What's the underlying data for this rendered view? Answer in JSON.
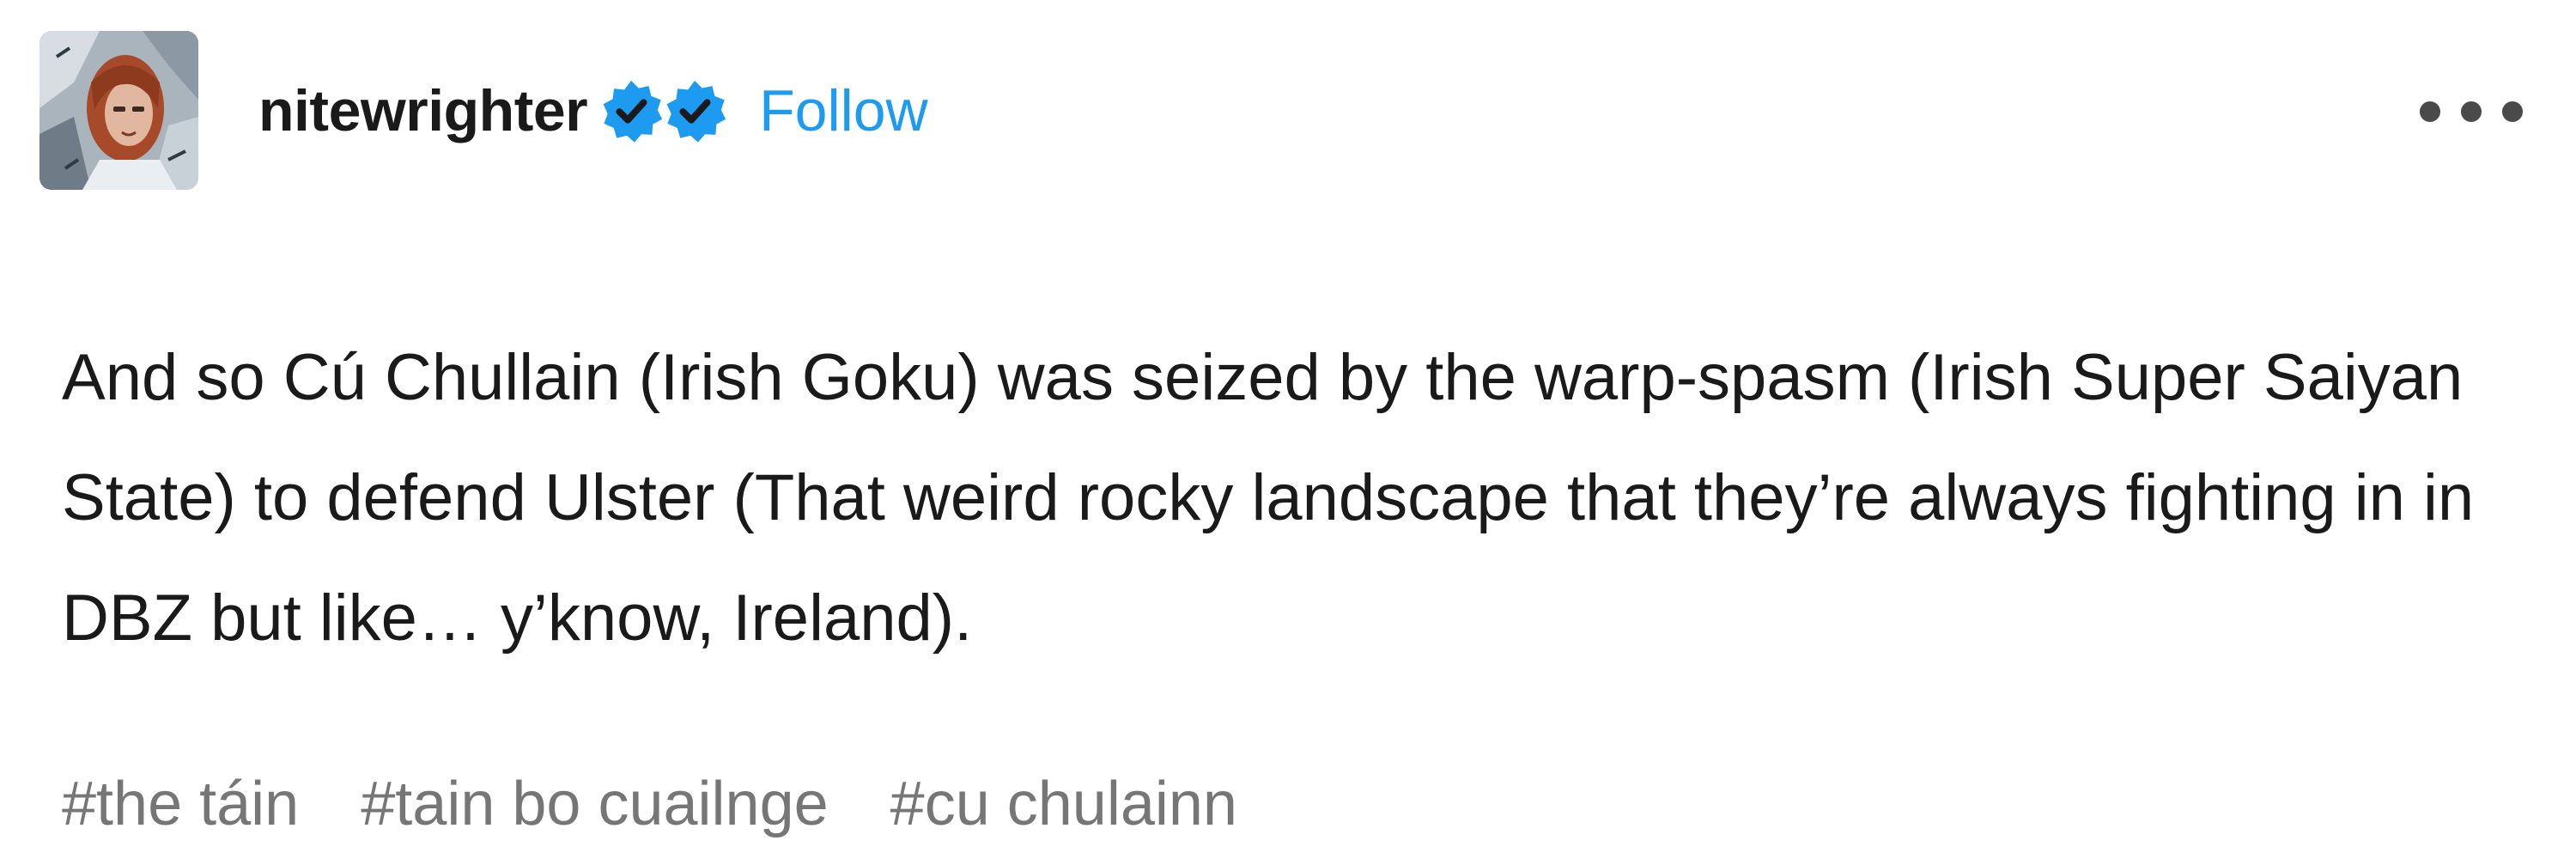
{
  "post": {
    "blog_name": "nitewrighter",
    "follow_label": "Follow",
    "body": "And so Cú Chullain (Irish Goku) was seized by the warp-spasm (Irish Super Saiyan State) to defend Ulster (That weird rocky landscape that they’re always fighting in in DBZ but like… y’know, Ireland).",
    "tags": [
      "#the táin",
      "#tain bo cuailnge",
      "#cu chulainn"
    ],
    "badge_icons": [
      "verified-badge-icon",
      "verified-badge-icon"
    ],
    "more_icon": "ellipsis-icon"
  },
  "colors": {
    "accent": "#1d9bf0",
    "text": "#1a1a1a",
    "tag_text": "#767676",
    "badge_check": "#1a1a1a"
  }
}
